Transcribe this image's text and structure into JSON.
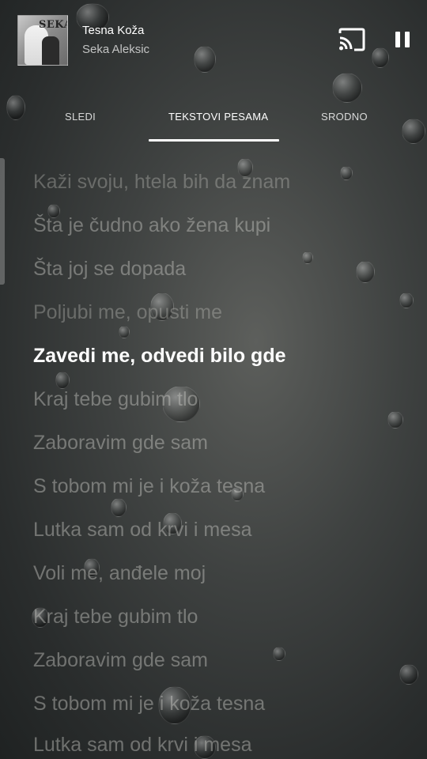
{
  "now_playing": {
    "title": "Tesna Koža",
    "artist": "Seka Aleksic",
    "album_art_text": "SEKA"
  },
  "controls": {
    "cast_icon": "cast-icon",
    "pause_icon": "pause-icon"
  },
  "tabs": [
    {
      "label": "SLEDI",
      "active": false
    },
    {
      "label": "TEKSTOVI PESAMA",
      "active": true
    },
    {
      "label": "SRODNO",
      "active": false
    }
  ],
  "lyrics": [
    "Kaži svoju, htela bih da znam",
    "Šta je čudno ako žena kupi",
    "Šta joj se dopada",
    "Poljubi me, opusti me",
    "Zavedi me, odvedi bilo gde",
    "Kraj tebe gubim tlo",
    "Zaboravim gde sam",
    "S tobom mi je i koža tesna",
    "Lutka sam od krvi i mesa",
    "Voli me, anđele moj",
    "Kraj tebe gubim tlo",
    "Zaboravim gde sam",
    "S tobom mi je i koža tesna",
    "Lutka sam od krvi i mesa"
  ],
  "current_line_index": 4
}
